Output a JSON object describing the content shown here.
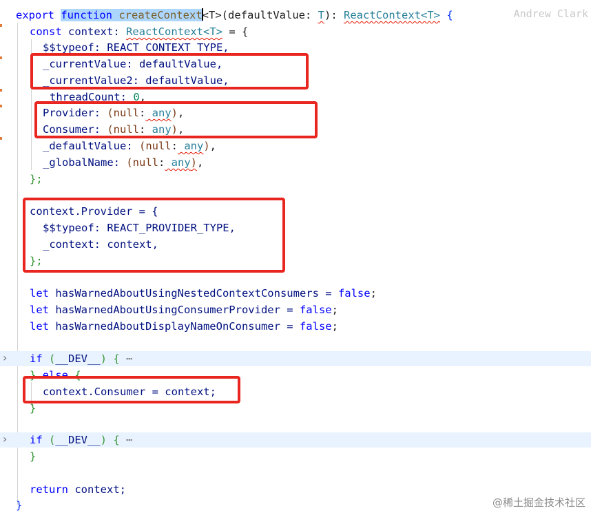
{
  "blame": "Andrew Clark",
  "watermark": "@稀土掘金技术社区",
  "lines": {
    "l1": {
      "export": "export",
      "function": "function",
      "name": "createContext",
      "g1": "<T>(defaultValue: ",
      "t1": "T",
      "g2": "): ",
      "ret": "ReactContext<T>",
      "g3": " {"
    },
    "l2": {
      "const": "const",
      "rest": " context: ",
      "type": "ReactContext<T>",
      "end": " = {"
    },
    "l3": "$$typeof: REACT_CONTEXT_TYPE,",
    "l4": "_currentValue: defaultValue,",
    "l5": "_currentValue2: defaultValue,",
    "l6": {
      "key": "threadCount: ",
      "num": "0",
      "end": ","
    },
    "l7": {
      "key": "Provider: ",
      "null": "(null",
      "colon": ":",
      "any": " any",
      "close": ")",
      "end": ","
    },
    "l8": {
      "key": "Consumer: ",
      "null": "(null",
      "colon": ":",
      "any": " any",
      "close": ")",
      "end": ","
    },
    "l9": {
      "key": "_defaultValue: ",
      "null": "(null",
      "colon": ":",
      "any": " any",
      "close": ")",
      "end": ","
    },
    "l10": {
      "key": "_globalName: ",
      "null": "(null",
      "colon": ":",
      "any": " any",
      "close": ")",
      "end": ","
    },
    "l11": "};",
    "l13": "context.Provider = {",
    "l14": "$$typeof: REACT_PROVIDER_TYPE,",
    "l15": "_context: context,",
    "l16": "};",
    "l18": {
      "let": "let",
      "rest": " hasWarnedAboutUsingNestedContextConsumers = ",
      "val": "false",
      "end": ";"
    },
    "l19": {
      "let": "let",
      "rest": " hasWarnedAboutUsingConsumerProvider = ",
      "val": "false",
      "end": ";"
    },
    "l20": {
      "let": "let",
      "rest": " hasWarnedAboutDisplayNameOnConsumer = ",
      "val": "false",
      "end": ";"
    },
    "l22": {
      "if": "if",
      "open": " (",
      "dev": "__DEV__",
      "close": ")",
      "brace": " {",
      "ellipsis": "⋯"
    },
    "l23": {
      "close": "}",
      "else": " else",
      "open": " {"
    },
    "l24": "context.Consumer = context;",
    "l25": "}",
    "l27": {
      "if": "if",
      "open": " (",
      "dev": "__DEV__",
      "close": ")",
      "brace": " {",
      "ellipsis": "⋯"
    },
    "l28": "}",
    "l30": {
      "return": "return",
      "rest": " context;"
    },
    "l31": "}"
  },
  "icons": {
    "fold": "chevron-right-icon"
  },
  "colors": {
    "highlight_box": "#e8261f",
    "keyword": "#0000ff",
    "fold_row": "#e9f3ff"
  }
}
